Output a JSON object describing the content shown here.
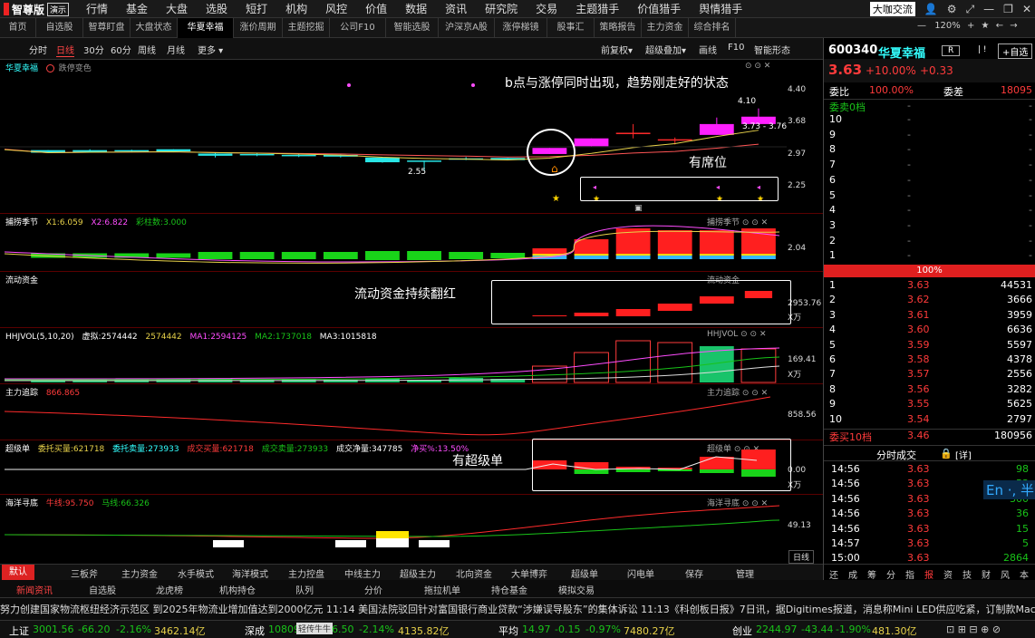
{
  "app": {
    "name": "智尊版",
    "badge": "演示"
  },
  "top_menu": [
    "行情",
    "基金",
    "大盘",
    "选股",
    "短打",
    "机构",
    "风控",
    "价值",
    "数据",
    "资讯",
    "研究院",
    "交易",
    "主题猎手",
    "价值猎手",
    "舆情猎手"
  ],
  "top_right": {
    "cafe": "大咖交流",
    "zoom": "120%"
  },
  "tabs": [
    "首页",
    "自选股",
    "智尊盯盘",
    "大盘状态",
    "华夏幸福",
    "涨价周期",
    "主题挖掘",
    "公司F10",
    "智能选股",
    "沪深京A股",
    "涨停梯镜",
    "股事汇",
    "策略报告",
    "主力资金",
    "综合排名"
  ],
  "active_tab": "华夏幸福",
  "toolbar": {
    "left": [
      "分时",
      "日线",
      "30分",
      "60分",
      "周线",
      "月线",
      "更多 ▾"
    ],
    "active": "日线",
    "right": [
      "前复权▾",
      "超级叠加▾",
      "画线",
      "F10",
      "智能形态"
    ]
  },
  "main_pane": {
    "title": "华夏幸福",
    "subtitle": "跌停变色",
    "yticks": [
      "4.40",
      "3.68",
      "2.97",
      "2.25"
    ],
    "labels": {
      "high": "4.10",
      "range": "3.73 - 3.76",
      "low": "2.55"
    }
  },
  "candles": [
    {
      "o": 3.03,
      "c": 2.97,
      "h": 3.03,
      "l": 2.97,
      "col": "cyan"
    },
    {
      "o": 3.03,
      "c": 2.99,
      "h": 3.05,
      "l": 2.97,
      "col": "cyan"
    },
    {
      "o": 3.03,
      "c": 3.0,
      "h": 3.04,
      "l": 2.98,
      "col": "cyan"
    },
    {
      "o": 3.05,
      "c": 3.0,
      "h": 3.05,
      "l": 2.98,
      "col": "cyan"
    },
    {
      "o": 2.95,
      "c": 2.9,
      "h": 2.97,
      "l": 2.86,
      "col": "cyan"
    },
    {
      "o": 2.94,
      "c": 2.91,
      "h": 2.95,
      "l": 2.89,
      "col": "cyan"
    },
    {
      "o": 2.92,
      "c": 2.89,
      "h": 2.93,
      "l": 2.87,
      "col": "cyan"
    },
    {
      "o": 2.92,
      "c": 2.88,
      "h": 2.93,
      "l": 2.86,
      "col": "cyan"
    },
    {
      "o": 2.86,
      "c": 2.75,
      "h": 2.87,
      "l": 2.74,
      "col": "cyan"
    },
    {
      "o": 2.79,
      "c": 2.76,
      "h": 2.79,
      "l": 2.55,
      "col": "cyan"
    },
    {
      "o": 2.84,
      "c": 2.83,
      "h": 2.87,
      "l": 2.8,
      "col": "cyan"
    },
    {
      "o": 2.85,
      "c": 2.8,
      "h": 2.85,
      "l": 2.8,
      "col": "cyan"
    },
    {
      "o": 2.94,
      "c": 3.08,
      "h": 3.08,
      "l": 2.94,
      "col": "magenta"
    },
    {
      "o": 3.12,
      "c": 3.3,
      "h": 3.3,
      "l": 3.12,
      "col": "magenta"
    },
    {
      "o": 3.43,
      "c": 3.43,
      "h": 3.63,
      "l": 3.3,
      "col": "red"
    },
    {
      "o": 3.26,
      "c": 3.28,
      "h": 3.32,
      "l": 3.16,
      "col": "red"
    },
    {
      "o": 3.38,
      "c": 3.63,
      "h": 3.78,
      "l": 3.38,
      "col": "magenta"
    },
    {
      "o": 3.63,
      "c": 3.8,
      "h": 3.99,
      "l": 3.63,
      "col": "magenta"
    }
  ],
  "annotations": {
    "b_point": "b点与涨停同时出现，趋势刚走好的状态",
    "seat": "有席位",
    "liquid": "流动资金持续翻红",
    "super": "有超级单"
  },
  "panes": {
    "season": {
      "title": "捕捞季节",
      "x1": "X1:6.059",
      "x2": "X2:6.822",
      "bars": "彩柱数:3.000",
      "ytick": "2.04",
      "right": "捕捞季节"
    },
    "liquidity": {
      "title": "流动资金",
      "ytick": "2953.76",
      "unit": "X万",
      "right": "流动资金"
    },
    "hhjvol": {
      "title": "HHJVOL(5,10,20)",
      "v": "虚拟:2574442",
      "v2": "2574442",
      "ma1": "MA1:2594125",
      "ma2": "MA2:1737018",
      "ma3": "MA3:1015818",
      "ytick": "169.41",
      "unit": "X万",
      "right": "HHJVOL"
    },
    "main_track": {
      "title": "主力追踪",
      "val": "866.865",
      "ytick": "858.56",
      "right": "主力追踪"
    },
    "super_order": {
      "title": "超级单",
      "a": "委托买量:621718",
      "b": "委托卖量:273933",
      "c": "成交买量:621718",
      "d": "成交卖量:273933",
      "e": "成交净量:347785",
      "f": "净买%:13.50%",
      "ytick": "0.00",
      "unit": "X万",
      "right": "超级单"
    },
    "ocean": {
      "title": "海洋寻底",
      "n": "牛线:95.750",
      "m": "马线:66.326",
      "ytick": "49.13",
      "right": "海洋寻底",
      "period": "日线"
    }
  },
  "bottom_tabs": [
    "默认",
    "三板斧",
    "主力资金",
    "水手模式",
    "海洋模式",
    "主力控盘",
    "中线主力",
    "超级主力",
    "北向资金",
    "大单博弈",
    "超级单",
    "闪电单",
    "保存",
    "管理"
  ],
  "right": {
    "code": "600340",
    "name": "华夏幸福",
    "tag": "R",
    "btn": "+自选",
    "price": "3.63",
    "pct": "+10.00%",
    "chg": "+0.33",
    "weibi_label": "委比",
    "weibi": "100.00%",
    "weicha_label": "委差",
    "weicha": "18095",
    "sell_header": "委卖0档",
    "sell_levels": [
      "10",
      "9",
      "8",
      "7",
      "6",
      "5",
      "4",
      "3",
      "2",
      "1"
    ],
    "pct_bar": "100%",
    "buy_levels": [
      [
        "1",
        "3.63",
        "44531"
      ],
      [
        "2",
        "3.62",
        "3666"
      ],
      [
        "3",
        "3.61",
        "3959"
      ],
      [
        "4",
        "3.60",
        "6636"
      ],
      [
        "5",
        "3.59",
        "5597"
      ],
      [
        "6",
        "3.58",
        "4378"
      ],
      [
        "7",
        "3.57",
        "2556"
      ],
      [
        "8",
        "3.56",
        "3282"
      ],
      [
        "9",
        "3.55",
        "5625"
      ],
      [
        "10",
        "3.54",
        "2797"
      ]
    ],
    "buy_total": [
      "委买10档",
      "3.46",
      "180956"
    ],
    "trades_title": "分时成交",
    "trades_detail": "[详]",
    "trades": [
      [
        "14:56",
        "3.63",
        "98"
      ],
      [
        "14:56",
        "3.63",
        "53"
      ],
      [
        "14:56",
        "3.63",
        "300"
      ],
      [
        "14:56",
        "3.63",
        "36"
      ],
      [
        "14:56",
        "3.63",
        "15"
      ],
      [
        "14:57",
        "3.63",
        "5"
      ],
      [
        "15:00",
        "3.63",
        "2864"
      ]
    ],
    "side_tabs": [
      "还",
      "成",
      "筹",
      "分",
      "指",
      "报",
      "资",
      "技",
      "财",
      "风",
      "本"
    ],
    "ime": "En ·, 半"
  },
  "news_tabs": [
    "新闻资讯",
    "自选股",
    "龙虎榜",
    "机构持仓",
    "队列",
    "分价",
    "拖拉机单",
    "持仓基金",
    "模拟交易"
  ],
  "ticker": "努力创建国家物流枢纽经济示范区 到2025年物流业增加值达到2000亿元     11:14 美国法院驳回针对富国银行商业贷款“涉嫌误导股东”的集体诉讼     11:13《科创板日报》7日讯，据Digitimes报道，消息称Mini LED供应吃紧，订制款MacBo",
  "status": {
    "sh_label": "上证",
    "sh": "3001.56",
    "sh_chg": "-66.20",
    "sh_pct": "-2.16%",
    "sh_amt": "3462.14亿",
    "sz_label": "深成",
    "sz": "10809",
    "popup": "轻传牛牛",
    "sz2": "6.50",
    "sz_pct": "-2.14%",
    "sz_amt": "4135.82亿",
    "avg_label": "平均",
    "avg": "14.97",
    "avg_chg": "-0.15",
    "avg_pct": "-0.97%",
    "avg_amt": "7480.27亿",
    "cy_label": "创业",
    "cy": "2244.97",
    "cy_chg": "-43.44",
    "cy_pct": "-1.90%",
    "cy_amt": "481.30亿"
  }
}
